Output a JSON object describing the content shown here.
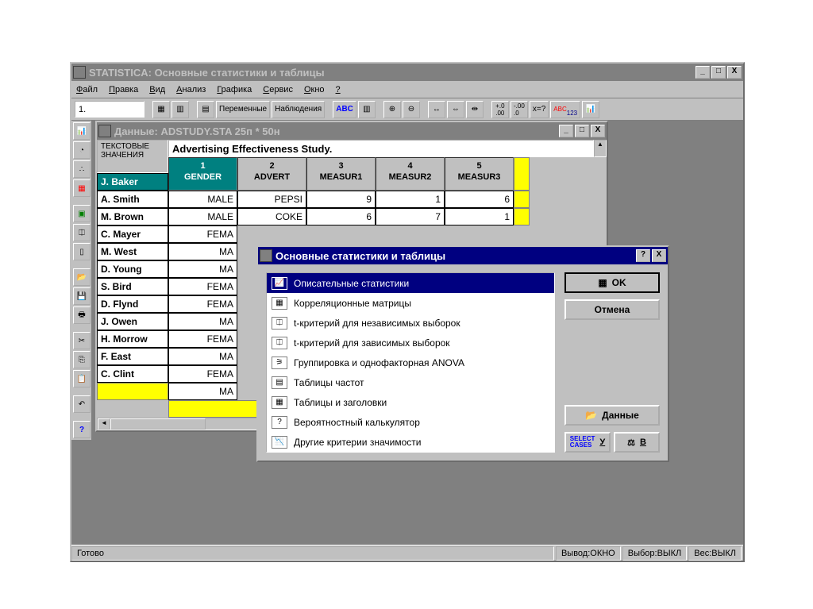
{
  "app": {
    "title": "STATISTICA: Основные статистики и таблицы",
    "input_field": "1."
  },
  "menu": {
    "file": "Файл",
    "edit": "Правка",
    "view": "Вид",
    "analysis": "Анализ",
    "graphics": "Графика",
    "service": "Сервис",
    "window": "Окно",
    "help": "?"
  },
  "toolbar": {
    "variables": "Переменные",
    "observations": "Наблюдения"
  },
  "datawin": {
    "title": "Данные: ADSTUDY.STA 25п * 50н",
    "corner": "ТЕКСТОВЫЕ ЗНАЧЕНИЯ",
    "study": "Advertising Effectiveness Study.",
    "columns": [
      {
        "num": "1",
        "name": "GENDER"
      },
      {
        "num": "2",
        "name": "ADVERT"
      },
      {
        "num": "3",
        "name": "MEASUR1"
      },
      {
        "num": "4",
        "name": "MEASUR2"
      },
      {
        "num": "5",
        "name": "MEASUR3"
      }
    ],
    "rows": [
      {
        "h": "J. Baker",
        "c": [
          "MALE",
          "PEPSI",
          "9",
          "1",
          "6"
        ]
      },
      {
        "h": "A. Smith",
        "c": [
          "MALE",
          "COKE",
          "6",
          "7",
          "1"
        ]
      },
      {
        "h": "M. Brown",
        "c": [
          "FEMA",
          "",
          "",
          "",
          ""
        ]
      },
      {
        "h": "C. Mayer",
        "c": [
          "MA",
          "",
          "",
          "",
          ""
        ]
      },
      {
        "h": "M. West",
        "c": [
          "MA",
          "",
          "",
          "",
          ""
        ]
      },
      {
        "h": "D. Young",
        "c": [
          "FEMA",
          "",
          "",
          "",
          ""
        ]
      },
      {
        "h": "S. Bird",
        "c": [
          "FEMA",
          "",
          "",
          "",
          ""
        ]
      },
      {
        "h": "D. Flynd",
        "c": [
          "MA",
          "",
          "",
          "",
          ""
        ]
      },
      {
        "h": "J. Owen",
        "c": [
          "FEMA",
          "",
          "",
          "",
          ""
        ]
      },
      {
        "h": "H. Morrow",
        "c": [
          "MA",
          "",
          "",
          "",
          ""
        ]
      },
      {
        "h": "F. East",
        "c": [
          "FEMA",
          "",
          "",
          "",
          ""
        ]
      },
      {
        "h": "C. Clint",
        "c": [
          "MA",
          "",
          "",
          "",
          ""
        ]
      }
    ]
  },
  "dialog": {
    "title": "Основные статистики и таблицы",
    "options": [
      "Описательные статистики",
      "Корреляционные матрицы",
      "t-критерий для независимых выборок",
      "t-критерий для зависимых выборок",
      "Группировка и однофакторная ANOVA",
      "Таблицы частот",
      "Таблицы и заголовки",
      "Вероятностный калькулятор",
      "Другие критерии значимости"
    ],
    "ok": "OK",
    "cancel": "Отмена",
    "data": "Данные",
    "select_u": "У",
    "select_b": "В"
  },
  "status": {
    "ready": "Готово",
    "output": "Вывод:ОКНО",
    "select": "Выбор:ВЫКЛ",
    "weight": "Вес:ВЫКЛ"
  }
}
